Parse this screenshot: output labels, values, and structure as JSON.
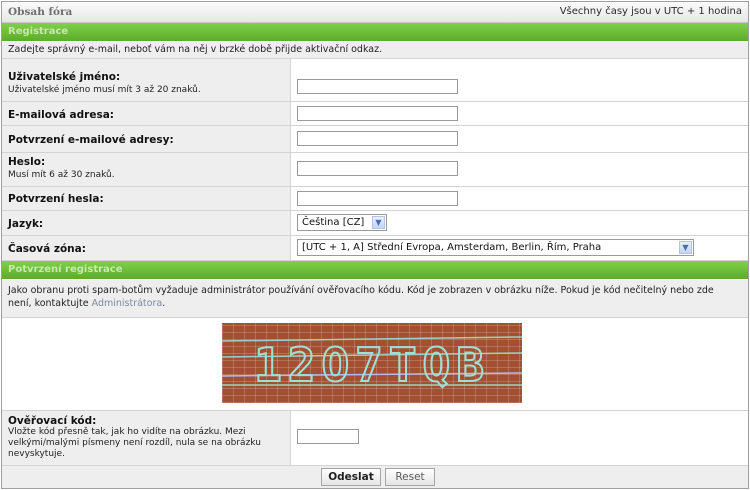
{
  "header": {
    "title": "Obsah fóra",
    "times": "Všechny časy jsou v UTC + 1 hodina"
  },
  "registration": {
    "section_title": "Registrace",
    "intro": "Zadejte správný e-mail, neboť vám na něj v brzké době přijde aktivační odkaz.",
    "username_label": "Uživatelské jméno:",
    "username_help": "Uživatelské jméno musí mít 3 až 20 znaků.",
    "email_label": "E-mailová adresa:",
    "email_confirm_label": "Potvrzení e-mailové adresy:",
    "password_label": "Heslo:",
    "password_help": "Musí mít 6 až 30 znaků.",
    "password_confirm_label": "Potvrzení hesla:",
    "language_label": "Jazyk:",
    "language_value": "Čeština [CZ]",
    "timezone_label": "Časová zóna:",
    "timezone_value": "[UTC + 1, A] Střední Evropa, Amsterdam, Berlin, Řím, Praha"
  },
  "confirmation": {
    "section_title": "Potvrzení registrace",
    "text": "Jako obranu proti spam-botům vyžaduje administrátor používání ověřovacího kódu. Kód je zobrazen v obrázku níže. Pokud je kód nečitelný nebo zde není, kontaktujte",
    "admin_link": "Administrátora",
    "text_end": ".",
    "captcha_text": "12O7TQB",
    "code_label": "Ověřovací kód:",
    "code_help": "Vložte kód přesně tak, jak ho vidíte na obrázku. Mezi velkými/malými písmeny není rozdíl, nula se na obrázku nevyskytuje."
  },
  "buttons": {
    "submit": "Odeslat",
    "reset": "Reset"
  },
  "colors": {
    "section_bar": "#66b832",
    "label_bg": "#eeeeee",
    "link": "#7c8aa0"
  },
  "icons": [
    "chevron-down-icon"
  ]
}
